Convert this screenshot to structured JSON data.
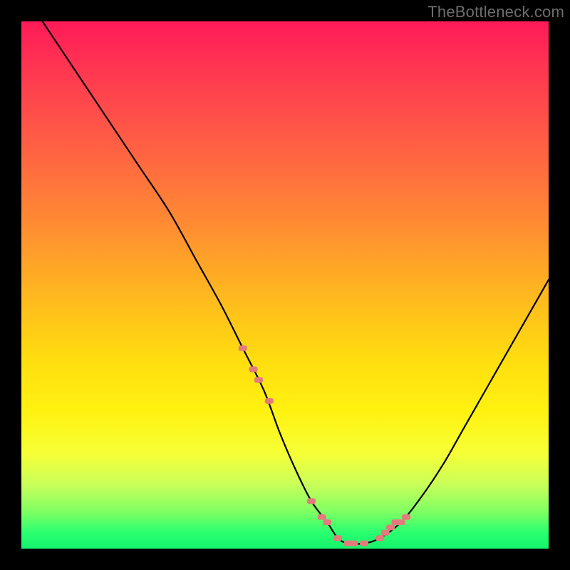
{
  "watermark": "TheBottleneck.com",
  "chart_data": {
    "type": "line",
    "title": "",
    "xlabel": "",
    "ylabel": "",
    "xlim": [
      0,
      100
    ],
    "ylim": [
      0,
      100
    ],
    "series": [
      {
        "name": "curve",
        "x": [
          4,
          10,
          16,
          22,
          28,
          33,
          38,
          42,
          46,
          49,
          52,
          55,
          58,
          60,
          62,
          65,
          68,
          72,
          76,
          80,
          84,
          88,
          92,
          96,
          100
        ],
        "values": [
          100,
          91,
          82,
          73,
          64,
          55,
          46,
          38,
          30,
          22,
          15,
          9,
          5,
          2,
          1,
          1,
          2,
          5,
          10,
          16,
          23,
          30,
          37,
          44,
          51
        ]
      }
    ],
    "markers": {
      "name": "highlight-dots",
      "color": "#e37b7d",
      "x": [
        42,
        44,
        45,
        47,
        55,
        57,
        58,
        60,
        62,
        63,
        65,
        68,
        69,
        70,
        71,
        72,
        73
      ],
      "values": [
        38,
        34,
        32,
        28,
        9,
        6,
        5,
        2,
        1,
        1,
        1,
        2,
        3,
        4,
        5,
        5,
        6
      ]
    },
    "gradient_stops": [
      {
        "pos": 0.0,
        "color": "#ff1a58"
      },
      {
        "pos": 0.5,
        "color": "#ffcc15"
      },
      {
        "pos": 0.8,
        "color": "#f6ff37"
      },
      {
        "pos": 1.0,
        "color": "#15f36b"
      }
    ]
  }
}
